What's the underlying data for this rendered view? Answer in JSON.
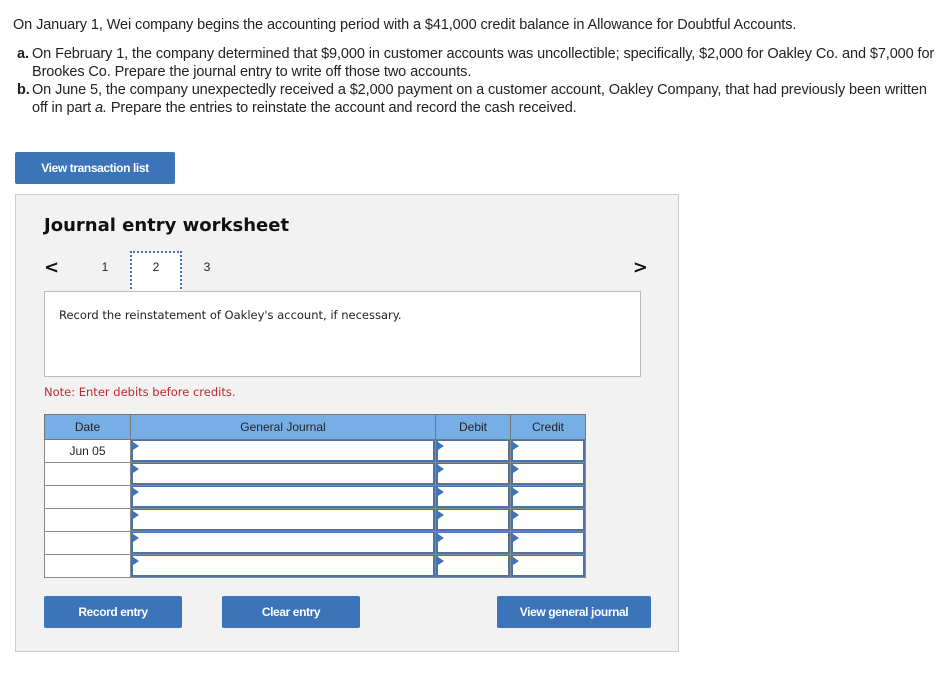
{
  "intro": {
    "text": "On January 1, Wei company begins the accounting period with a $41,000 credit balance in Allowance for Doubtful Accounts.",
    "parts": [
      {
        "letter": "a.",
        "text": "On February 1, the company determined that $9,000 in customer accounts was uncollectible; specifically, $2,000 for Oakley Co. and $7,000 for Brookes Co. Prepare the journal entry to write off those two accounts."
      },
      {
        "letter": "b.",
        "text_before": "On June 5, the company unexpectedly received a $2,000 payment on a customer account, Oakley Company, that had previously been written off in part ",
        "text_italic": "a.",
        "text_after": " Prepare the entries to reinstate the account and record the cash received."
      }
    ]
  },
  "buttons": {
    "view_transaction_list": "View transaction list",
    "record_entry": "Record entry",
    "clear_entry": "Clear entry",
    "view_general_journal": "View general journal"
  },
  "worksheet": {
    "title": "Journal entry worksheet",
    "pager": {
      "prev": "<",
      "next": ">",
      "pages": [
        "1",
        "2",
        "3"
      ],
      "current": "2"
    },
    "instruction": "Record the reinstatement of Oakley's account, if necessary.",
    "note": "Note: Enter debits before credits.",
    "table": {
      "headers": [
        "Date",
        "General Journal",
        "Debit",
        "Credit"
      ],
      "rows": [
        {
          "date": "Jun 05",
          "account": "",
          "debit": "",
          "credit": ""
        },
        {
          "date": "",
          "account": "",
          "debit": "",
          "credit": ""
        },
        {
          "date": "",
          "account": "",
          "debit": "",
          "credit": ""
        },
        {
          "date": "",
          "account": "",
          "debit": "",
          "credit": ""
        },
        {
          "date": "",
          "account": "",
          "debit": "",
          "credit": ""
        },
        {
          "date": "",
          "account": "",
          "debit": "",
          "credit": ""
        }
      ]
    }
  },
  "colors": {
    "button_bg": "#3b74b9",
    "header_bg": "#78aee6",
    "note_text": "#c0282d",
    "worksheet_bg": "#f2f2f2"
  }
}
